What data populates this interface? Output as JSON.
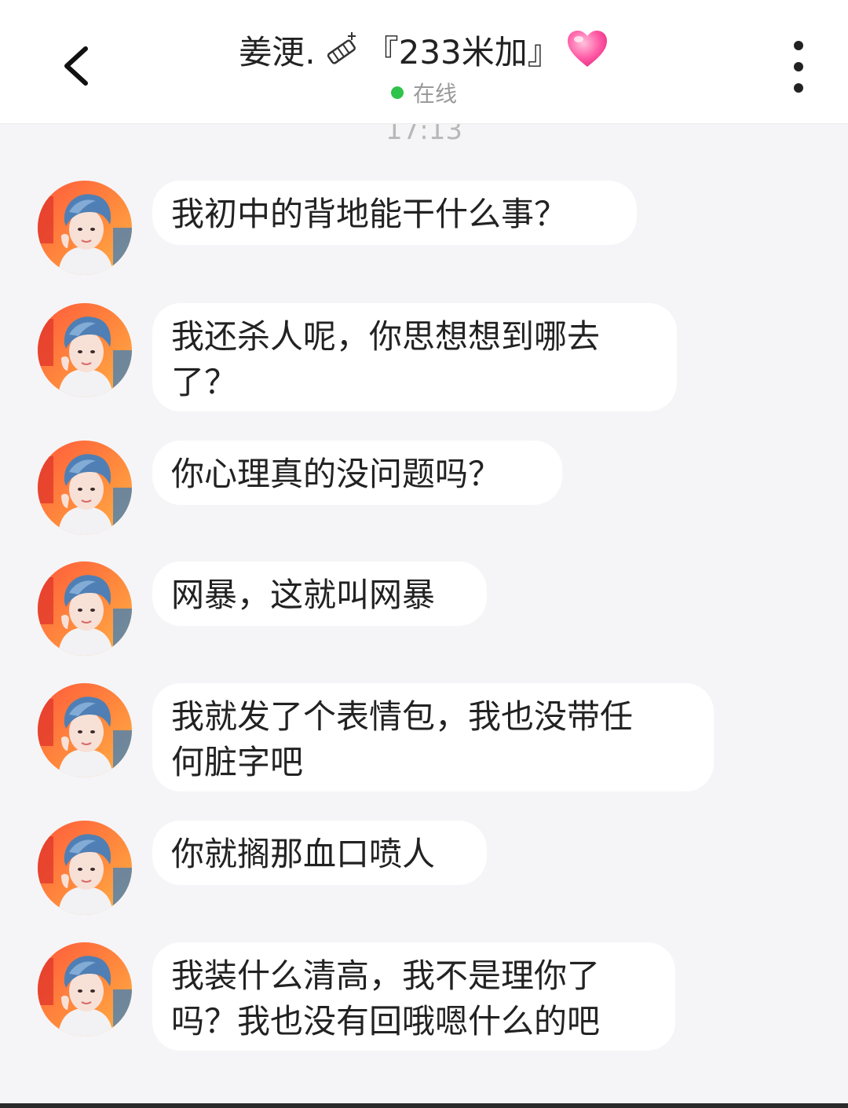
{
  "header": {
    "name": "姜浭.",
    "suffix": "『233米加』",
    "status": "在线",
    "status_color": "#2ec34a",
    "back_icon": "chevron-left-icon",
    "more_icon": "vertical-dots-icon",
    "decorations": [
      "lighter-icon",
      "heart-icon"
    ]
  },
  "timestamp": "17:13",
  "messages": [
    {
      "text": "我初中的背地能干什么事？"
    },
    {
      "text": "我还杀人呢，你思想想到哪去\n了？"
    },
    {
      "text": "你心理真的没问题吗？"
    },
    {
      "text": "网暴，这就叫网暴"
    },
    {
      "text": "我就发了个表情包，我也没带任\n何脏字吧"
    },
    {
      "text": "你就搁那血口喷人"
    },
    {
      "text": "我装什么清高，我不是理你了\n吗？我也没有回哦嗯什么的吧"
    }
  ]
}
